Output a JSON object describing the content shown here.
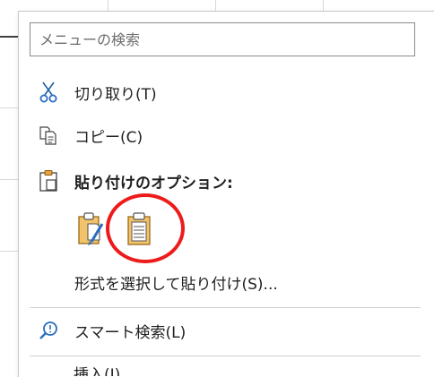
{
  "search": {
    "placeholder": "メニューの検索"
  },
  "menu": {
    "cut_label": "切り取り(T)",
    "copy_label": "コピー(C)",
    "paste_options_label": "貼り付けのオプション:",
    "paste_special_label": "形式を選択して貼り付け(S)...",
    "smart_lookup_label": "スマート検索(L)",
    "cutoff_label": "挿入(I)"
  },
  "paste_options": [
    {
      "icon": "paste-keep-source-formatting-icon"
    },
    {
      "icon": "paste-values-icon"
    }
  ],
  "annotation": {
    "circle_color": "#ee1b1b"
  },
  "icons": {
    "cut": "scissors-icon",
    "copy": "copy-icon",
    "paste": "clipboard-icon",
    "smart_lookup": "smart-lookup-icon"
  }
}
